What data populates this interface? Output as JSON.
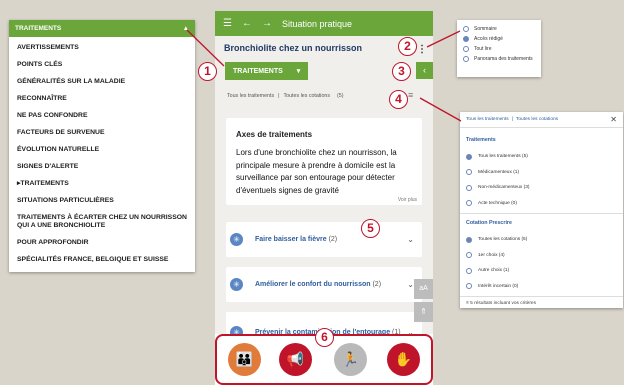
{
  "menu": {
    "header": "TRAITEMENTS",
    "items": [
      {
        "label": "AVERTISSEMENTS",
        "active": false
      },
      {
        "label": "POINTS CLÉS",
        "active": false
      },
      {
        "label": "GÉNÉRALITÉS SUR LA MALADIE",
        "active": false
      },
      {
        "label": "RECONNAÎTRE",
        "active": false
      },
      {
        "label": "NE PAS CONFONDRE",
        "active": false
      },
      {
        "label": "FACTEURS DE SURVENUE",
        "active": false
      },
      {
        "label": "ÉVOLUTION NATURELLE",
        "active": false
      },
      {
        "label": "SIGNES D'ALERTE",
        "active": false
      },
      {
        "label": "TRAITEMENTS",
        "active": true
      },
      {
        "label": "SITUATIONS PARTICULIÈRES",
        "active": false
      },
      {
        "label": "TRAITEMENTS À ÉCARTER CHEZ UN NOURRISSON QUI A UNE BRONCHIOLITE",
        "active": false
      },
      {
        "label": "POUR APPROFONDIR",
        "active": false
      },
      {
        "label": "SPÉCIALITÉS FRANCE, BELGIQUE ET SUISSE",
        "active": false
      }
    ]
  },
  "phone": {
    "topbar_title": "Situation pratique",
    "title": "Bronchiolite chez un nourrisson",
    "section_button": "TRAITEMENTS",
    "filter_all_treatments": "Tous les traitements",
    "filter_all_quotes": "Toutes les cotations",
    "filter_count": "(5)",
    "axes_title": "Axes de traitements",
    "axes_text": "Lors d'une bronchiolite chez un nourrisson, la principale mesure à prendre à domicile est la surveillance par son entourage pour détecter d'éventuels signes de gravité",
    "voir_plus": "Voir plus",
    "accordions": [
      {
        "label": "Faire baisser la fièvre",
        "count": "(2)"
      },
      {
        "label": "Améliorer le confort du nourrisson",
        "count": "(2)"
      },
      {
        "label": "Prévenir la contamination de l'entourage",
        "count": "(1)"
      }
    ],
    "font_size_button": "aA",
    "scroll_top_button": "⇑"
  },
  "markers": [
    "1",
    "2",
    "3",
    "4",
    "5",
    "6"
  ],
  "options_menu": {
    "items": [
      {
        "label": "Sommaire",
        "selected": false
      },
      {
        "label": "Accès rédigé",
        "selected": true
      },
      {
        "label": "Tout lire",
        "selected": false
      },
      {
        "label": "Panorama des traitements",
        "selected": false
      }
    ]
  },
  "filter_panel": {
    "tab_all_treatments": "Tous les traitements",
    "tab_all_quotes": "Toutes les cotations",
    "treatments_header": "Traitements",
    "treatments": [
      {
        "label": "Tous les traitements (5)",
        "selected": true
      },
      {
        "label": "Médicamenteux (1)",
        "selected": false
      },
      {
        "label": "Non-médicamenteux (3)",
        "selected": false
      },
      {
        "label": "Acte technique (0)",
        "selected": false
      }
    ],
    "cotation_header": "Cotation Prescrire",
    "cotations": [
      {
        "label": "Toutes les cotations (5)",
        "selected": true
      },
      {
        "label": "1er choix (4)",
        "selected": false
      },
      {
        "label": "Autre choix (1)",
        "selected": false
      },
      {
        "label": "Intérêt incertain (0)",
        "selected": false
      }
    ],
    "footer": "5 résultats incluant vos critères"
  },
  "colors": {
    "green": "#6aa63a",
    "marker_red": "#c0142b",
    "link_blue": "#2f5d9e",
    "icon_blue": "#5a86c4"
  }
}
